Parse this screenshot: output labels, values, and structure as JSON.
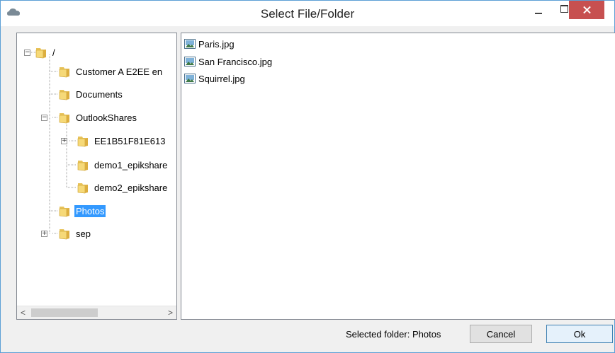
{
  "window": {
    "title": "Select File/Folder",
    "accent": "#c75050"
  },
  "tree": {
    "items": [
      {
        "label": "/",
        "expander": "−"
      },
      {
        "label": "Customer A E2EE en"
      },
      {
        "label": "Documents"
      },
      {
        "label": "OutlookShares",
        "expander": "−"
      },
      {
        "label": "EE1B51F81E613",
        "expander": "+"
      },
      {
        "label": "demo1_epikshare"
      },
      {
        "label": "demo2_epikshare"
      },
      {
        "label": "Photos",
        "selected": true
      },
      {
        "label": "sep",
        "expander": "+"
      }
    ]
  },
  "files": [
    {
      "label": "Paris.jpg",
      "icon": "image-file-icon"
    },
    {
      "label": "San Francisco.jpg",
      "icon": "image-file-icon"
    },
    {
      "label": "Squirrel.jpg",
      "icon": "image-file-icon"
    }
  ],
  "status": {
    "selected_folder": "Selected folder: Photos",
    "cancel_label": "Cancel",
    "ok_label": "Ok"
  },
  "scrollbar": {
    "left_arrow": "<",
    "right_arrow": ">"
  }
}
